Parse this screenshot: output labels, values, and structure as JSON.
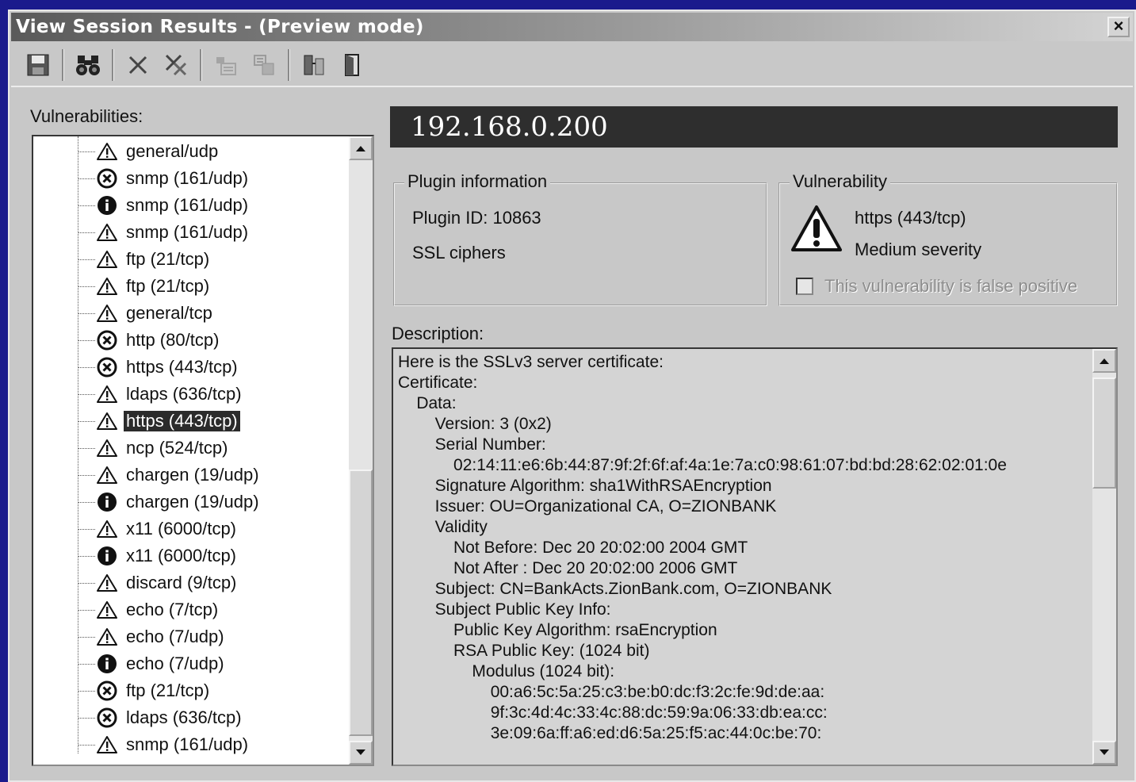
{
  "window": {
    "title": "View Session Results -  (Preview mode)",
    "close_label": "×"
  },
  "toolbar": {
    "buttons": [
      {
        "icon": "save-icon",
        "enabled": true
      },
      {
        "icon": "find-icon",
        "enabled": true
      },
      {
        "icon": "delete-icon",
        "enabled": true
      },
      {
        "icon": "delete-all-icon",
        "enabled": true
      },
      {
        "icon": "report-icon",
        "enabled": false
      },
      {
        "icon": "export-icon",
        "enabled": false
      },
      {
        "icon": "compare-icon",
        "enabled": true
      },
      {
        "icon": "exit-icon",
        "enabled": true
      }
    ]
  },
  "vulnerabilities": {
    "label": "Vulnerabilities:",
    "items": [
      {
        "icon": "warning-icon",
        "label": "general/udp"
      },
      {
        "icon": "error-icon",
        "label": "snmp (161/udp)"
      },
      {
        "icon": "info-icon",
        "label": "snmp (161/udp)"
      },
      {
        "icon": "warning-icon",
        "label": "snmp (161/udp)"
      },
      {
        "icon": "warning-icon",
        "label": "ftp (21/tcp)"
      },
      {
        "icon": "warning-icon",
        "label": "ftp (21/tcp)"
      },
      {
        "icon": "warning-icon",
        "label": "general/tcp"
      },
      {
        "icon": "error-icon",
        "label": "http (80/tcp)"
      },
      {
        "icon": "error-icon",
        "label": "https (443/tcp)"
      },
      {
        "icon": "warning-icon",
        "label": "ldaps (636/tcp)"
      },
      {
        "icon": "warning-icon",
        "label": "https (443/tcp)",
        "selected": true
      },
      {
        "icon": "warning-icon",
        "label": "ncp (524/tcp)"
      },
      {
        "icon": "warning-icon",
        "label": "chargen (19/udp)"
      },
      {
        "icon": "info-icon",
        "label": "chargen (19/udp)"
      },
      {
        "icon": "warning-icon",
        "label": "x11 (6000/tcp)"
      },
      {
        "icon": "info-icon",
        "label": "x11 (6000/tcp)"
      },
      {
        "icon": "warning-icon",
        "label": "discard (9/tcp)"
      },
      {
        "icon": "warning-icon",
        "label": "echo (7/tcp)"
      },
      {
        "icon": "warning-icon",
        "label": "echo (7/udp)"
      },
      {
        "icon": "info-icon",
        "label": "echo (7/udp)"
      },
      {
        "icon": "error-icon",
        "label": "ftp (21/tcp)"
      },
      {
        "icon": "error-icon",
        "label": "ldaps (636/tcp)"
      },
      {
        "icon": "warning-icon",
        "label": "snmp (161/udp)"
      }
    ]
  },
  "host": {
    "ip": "192.168.0.200"
  },
  "plugin_info": {
    "title": "Plugin information",
    "plugin_id": "Plugin ID: 10863",
    "plugin_name": "SSL ciphers"
  },
  "vulnerability": {
    "title": "Vulnerability",
    "port": "https (443/tcp)",
    "severity": "Medium severity",
    "false_positive_label": "This vulnerability is false positive",
    "false_positive_checked": false
  },
  "description": {
    "label": "Description:",
    "lines": [
      "Here is the SSLv3 server certificate:",
      "Certificate:",
      "    Data:",
      "        Version: 3 (0x2)",
      "        Serial Number:",
      "            02:14:11:e6:6b:44:87:9f:2f:6f:af:4a:1e:7a:c0:98:61:07:bd:bd:28:62:02:01:0e",
      "        Signature Algorithm: sha1WithRSAEncryption",
      "        Issuer: OU=Organizational CA, O=ZIONBANK",
      "        Validity",
      "            Not Before: Dec 20 20:02:00 2004 GMT",
      "            Not After : Dec 20 20:02:00 2006 GMT",
      "        Subject: CN=BankActs.ZionBank.com, O=ZIONBANK",
      "        Subject Public Key Info:",
      "            Public Key Algorithm: rsaEncryption",
      "            RSA Public Key: (1024 bit)",
      "                Modulus (1024 bit):",
      "                    00:a6:5c:5a:25:c3:be:b0:dc:f3:2c:fe:9d:de:aa:",
      "                    9f:3c:4d:4c:33:4c:88:dc:59:9a:06:33:db:ea:cc:",
      "                    3e:09:6a:ff:a6:ed:d6:5a:25:f5:ac:44:0c:be:70:"
    ]
  }
}
